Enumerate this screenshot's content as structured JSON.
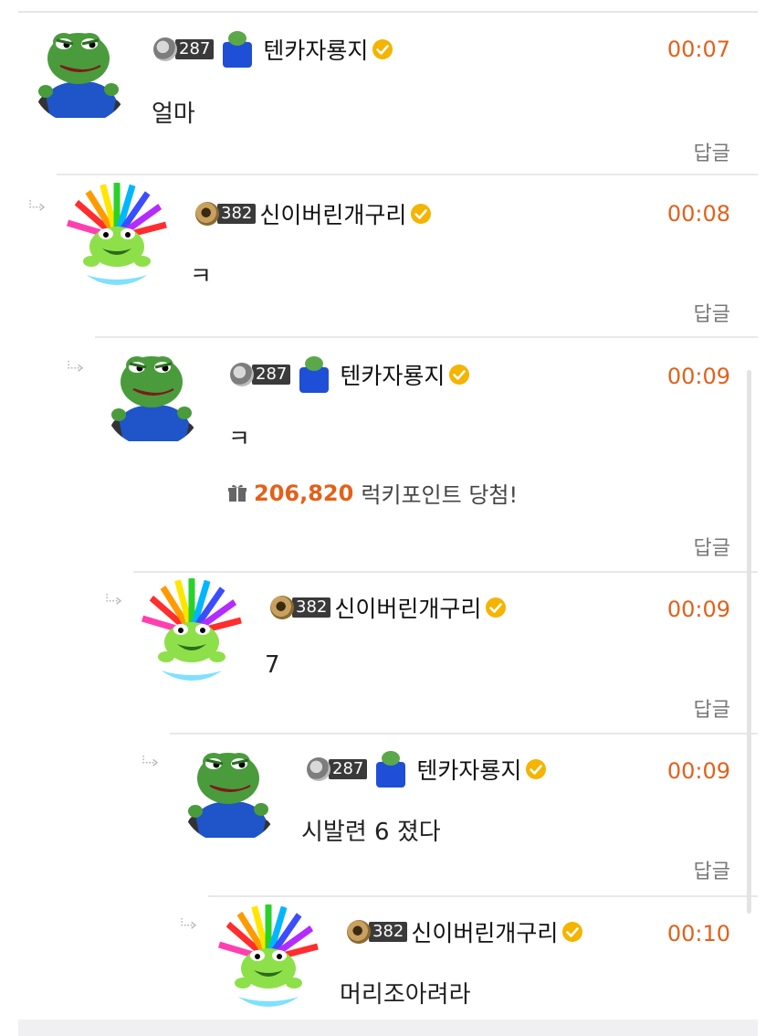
{
  "comments": [
    {
      "nickname": "텐카자룡지",
      "level": "287",
      "time": "00:07",
      "text": "얼마",
      "reply_label": "답글"
    },
    {
      "nickname": "신이버린개구리",
      "level": "382",
      "time": "00:08",
      "text": "ㅋ",
      "reply_label": "답글"
    },
    {
      "nickname": "텐카자룡지",
      "level": "287",
      "time": "00:09",
      "text": "ㅋ",
      "reply_label": "답글",
      "lucky": {
        "points": "206,820",
        "label": "럭키포인트 당첨!"
      }
    },
    {
      "nickname": "신이버린개구리",
      "level": "382",
      "time": "00:09",
      "text": "7",
      "reply_label": "답글"
    },
    {
      "nickname": "텐카자룡지",
      "level": "287",
      "time": "00:09",
      "text": "시발련 6 졌다",
      "reply_label": "답글"
    },
    {
      "nickname": "신이버린개구리",
      "level": "382",
      "time": "00:10",
      "text": "머리조아려라"
    }
  ],
  "colors": {
    "time": "#e2611b",
    "lucky_points": "#e2611b",
    "verified": "#f4b400"
  },
  "icons": {
    "reply_arrow": "reply-arrow-icon",
    "verified": "verified-badge-icon",
    "gift": "gift-icon"
  }
}
